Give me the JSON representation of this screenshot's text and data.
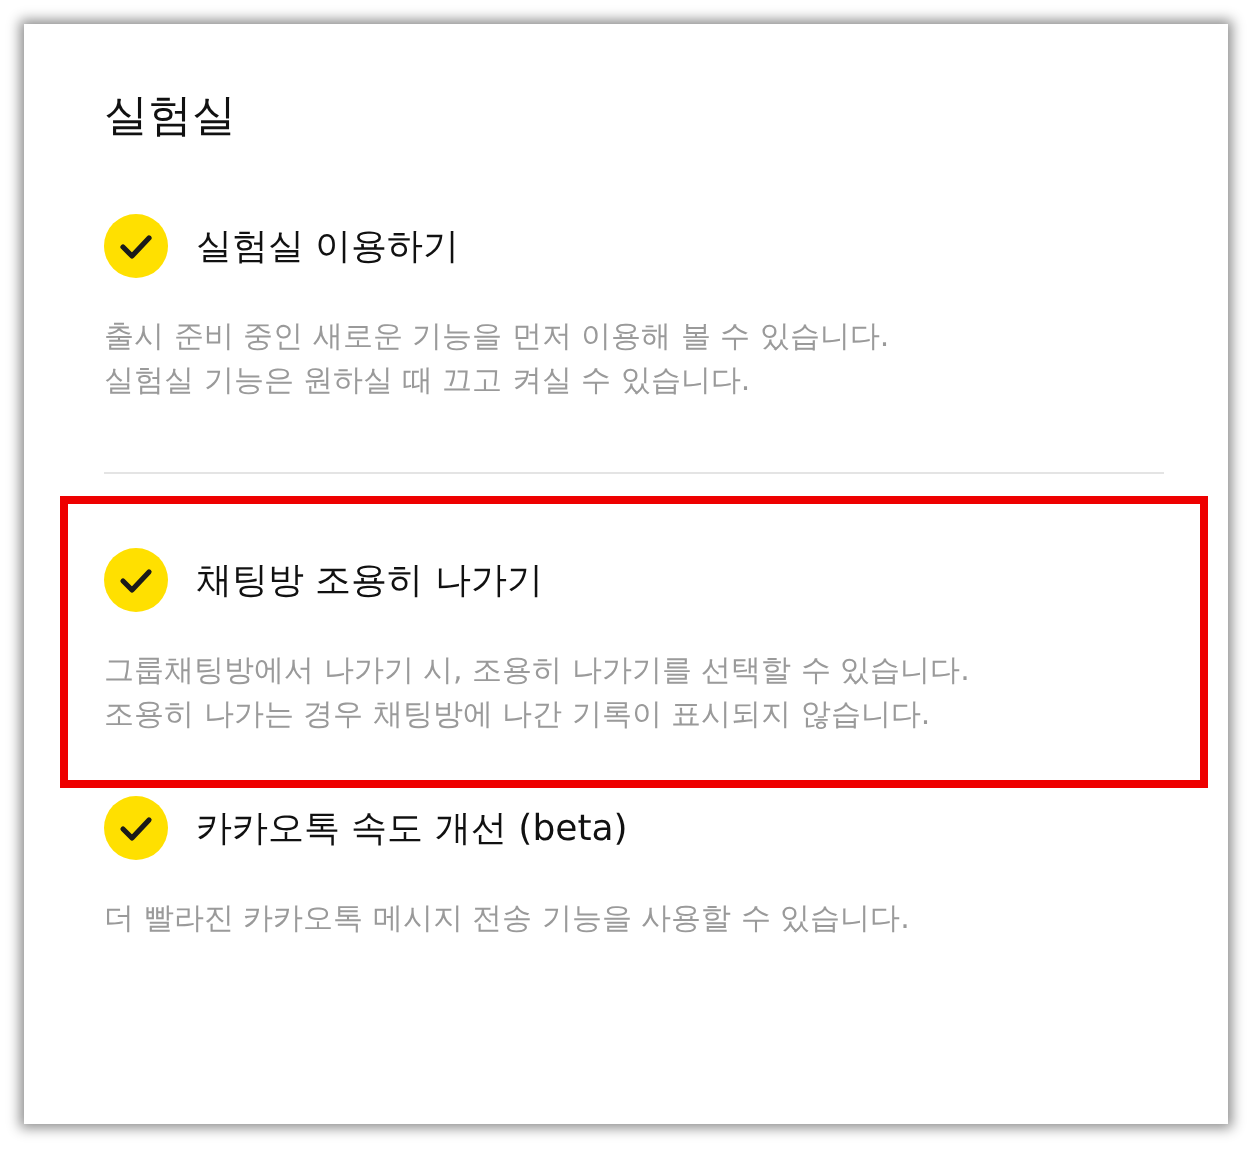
{
  "title": "실험실",
  "items": [
    {
      "label": "실험실 이용하기",
      "checked": true,
      "highlighted": false,
      "divider_after": true,
      "description_lines": [
        "출시 준비 중인 새로운 기능을 먼저 이용해 볼 수 있습니다.",
        "실험실 기능은 원하실 때 끄고 켜실 수 있습니다."
      ]
    },
    {
      "label": "채팅방 조용히 나가기",
      "checked": true,
      "highlighted": true,
      "divider_after": false,
      "description_lines": [
        "그룹채팅방에서 나가기 시, 조용히 나가기를 선택할 수 있습니다.",
        "조용히 나가는 경우 채팅방에 나간 기록이 표시되지 않습니다."
      ]
    },
    {
      "label": "카카오톡 속도 개선 (beta)",
      "checked": true,
      "highlighted": false,
      "divider_after": false,
      "description_lines": [
        "더 빨라진 카카오톡 메시지 전송 기능을 사용할 수 있습니다."
      ]
    }
  ]
}
